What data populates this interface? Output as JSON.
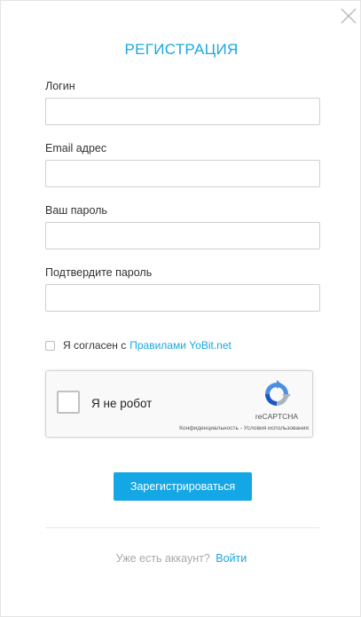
{
  "title": "РЕГИСТРАЦИЯ",
  "close_icon": "close-icon",
  "fields": {
    "login": {
      "label": "Логин",
      "value": "",
      "placeholder": ""
    },
    "email": {
      "label": "Email адрес",
      "value": "",
      "placeholder": ""
    },
    "password": {
      "label": "Ваш пароль",
      "value": "",
      "placeholder": ""
    },
    "confirm": {
      "label": "Подтвердите пароль",
      "value": "",
      "placeholder": ""
    }
  },
  "agree": {
    "text": "Я согласен с",
    "link": "Правилами YoBit.net",
    "checked": false
  },
  "recaptcha": {
    "label": "Я не робот",
    "brand": "reCAPTCHA",
    "links": "Конфиденциальность - Условия использования",
    "logo_icon": "recaptcha-logo-icon"
  },
  "submit_label": "Зарегистрироваться",
  "footer": {
    "text": "Уже есть аккаунт?",
    "link": "Войти"
  },
  "colors": {
    "accent": "#1aa8e0",
    "button": "#14a7e6"
  }
}
